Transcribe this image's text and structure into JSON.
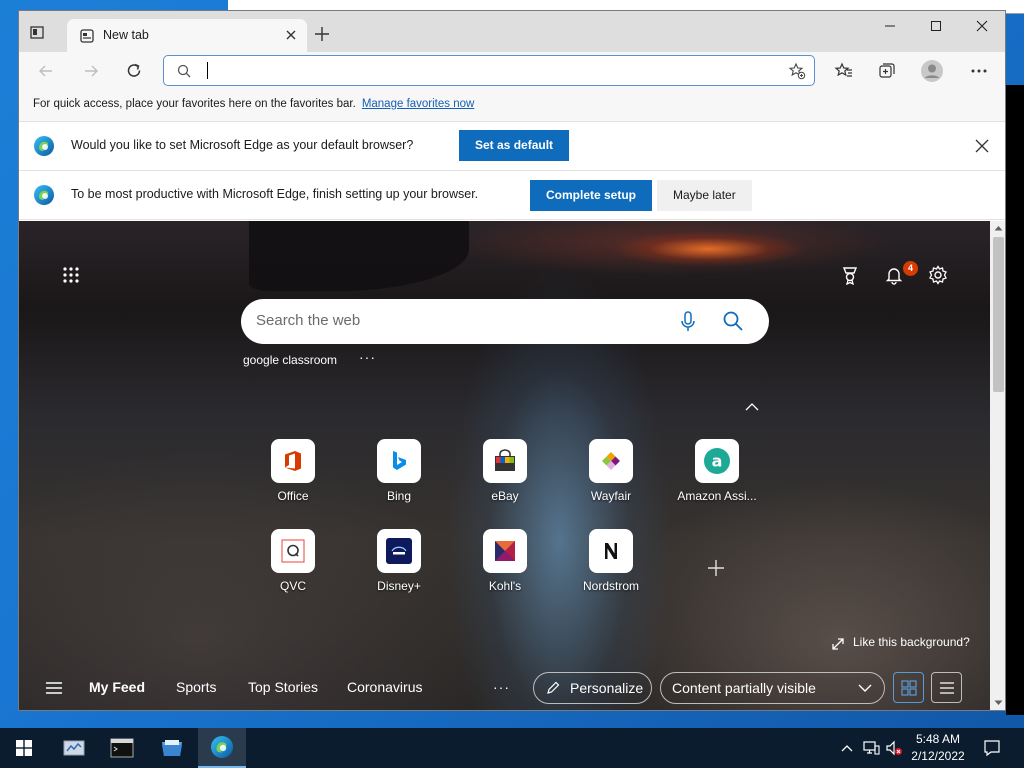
{
  "browser": {
    "tab_title": "New tab",
    "address_value": "",
    "favorites_bar": {
      "message": "For quick access, place your favorites here on the favorites bar.",
      "link": "Manage favorites now"
    },
    "default_prompt": {
      "message": "Would you like to set Microsoft Edge as your default browser?",
      "button": "Set as default"
    },
    "setup_prompt": {
      "message": "To be most productive with Microsoft Edge, finish setting up your browser.",
      "primary_button": "Complete setup",
      "secondary_button": "Maybe later"
    }
  },
  "ntp": {
    "notification_count": "4",
    "search_placeholder": "Search the web",
    "recent_search": "google classroom",
    "quick_links": [
      {
        "label": "Office",
        "icon": "office-icon"
      },
      {
        "label": "Bing",
        "icon": "bing-icon"
      },
      {
        "label": "eBay",
        "icon": "ebay-icon"
      },
      {
        "label": "Wayfair",
        "icon": "wayfair-icon"
      },
      {
        "label": "Amazon Assi...",
        "icon": "amazon-icon"
      },
      {
        "label": "QVC",
        "icon": "qvc-icon"
      },
      {
        "label": "Disney+",
        "icon": "disney-icon"
      },
      {
        "label": "Kohl's",
        "icon": "kohls-icon"
      },
      {
        "label": "Nordstrom",
        "icon": "nordstrom-icon"
      }
    ],
    "like_background": "Like this background?",
    "feed": {
      "items": [
        "My Feed",
        "Sports",
        "Top Stories",
        "Coronavirus"
      ],
      "personalize": "Personalize",
      "content_select": "Content partially visible"
    }
  },
  "taskbar": {
    "time": "5:48 AM",
    "date": "2/12/2022"
  },
  "colors": {
    "accent": "#0f6cbd",
    "badge": "#d83b01",
    "taskbar": "#0b1c2e"
  }
}
